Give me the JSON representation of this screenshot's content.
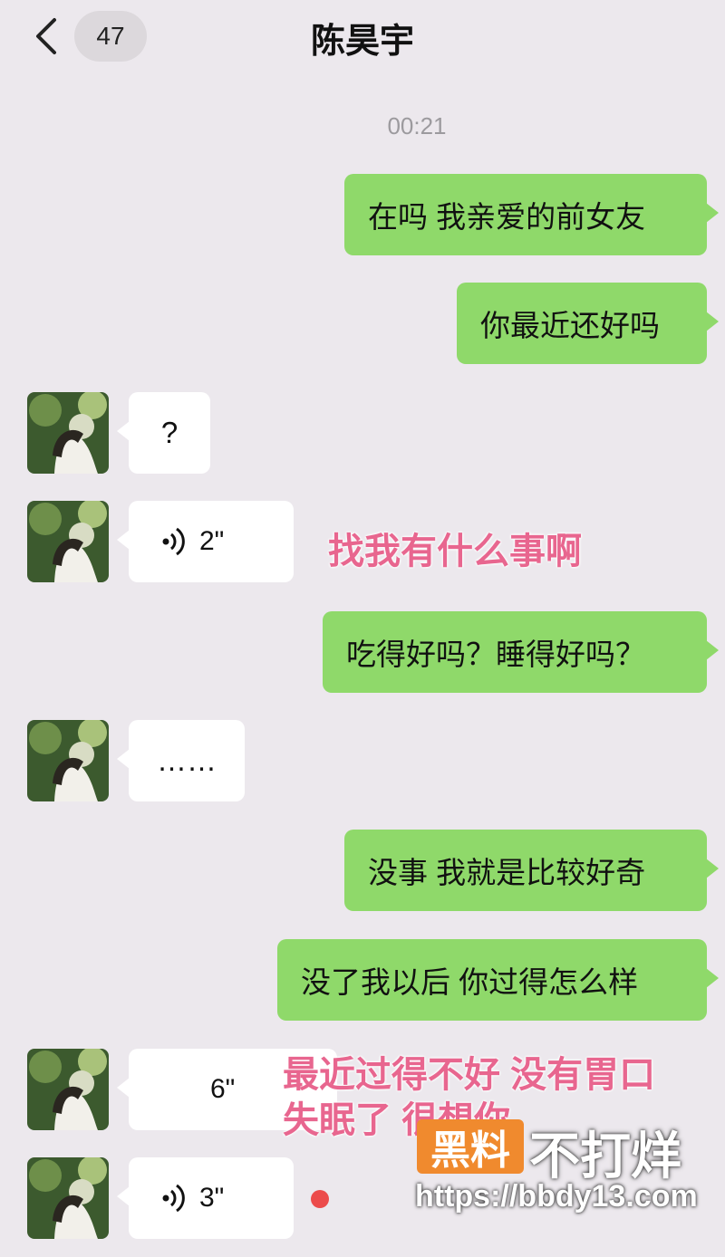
{
  "header": {
    "badge_count": "47",
    "contact_name": "陈昊宇"
  },
  "timestamp": "00:21",
  "messages": [
    {
      "type": "text",
      "from": "me",
      "text": "在吗  我亲爱的前女友"
    },
    {
      "type": "text",
      "from": "me",
      "text": "你最近还好吗"
    },
    {
      "type": "text",
      "from": "them",
      "text": "?"
    },
    {
      "type": "voice",
      "from": "them",
      "duration": "2\""
    },
    {
      "type": "text",
      "from": "me",
      "text": "吃得好吗？睡得好吗？"
    },
    {
      "type": "text",
      "from": "them",
      "text": "……"
    },
    {
      "type": "text",
      "from": "me",
      "text": "没事  我就是比较好奇"
    },
    {
      "type": "text",
      "from": "me",
      "text": "没了我以后  你过得怎么样"
    },
    {
      "type": "voice",
      "from": "them",
      "duration": "6\""
    },
    {
      "type": "voice",
      "from": "them",
      "duration": "3\""
    }
  ],
  "captions": {
    "voice1": "找我有什么事啊",
    "voice2_line1": "最近过得不好 没有胃口",
    "voice2_line2": "失眠了 很想你"
  },
  "watermark": {
    "box_text": "黑料",
    "main_text": "不打烊",
    "url": "https://bbdy13.com"
  },
  "colors": {
    "background": "#ece8ed",
    "my_bubble": "#8fd96a",
    "their_bubble": "#ffffff",
    "caption": "#e8668f",
    "unread_dot": "#ec4b4b",
    "watermark_box": "#f08a2e"
  },
  "icons": {
    "back": "chevron-left-icon",
    "voice": "voice-wave-icon"
  }
}
